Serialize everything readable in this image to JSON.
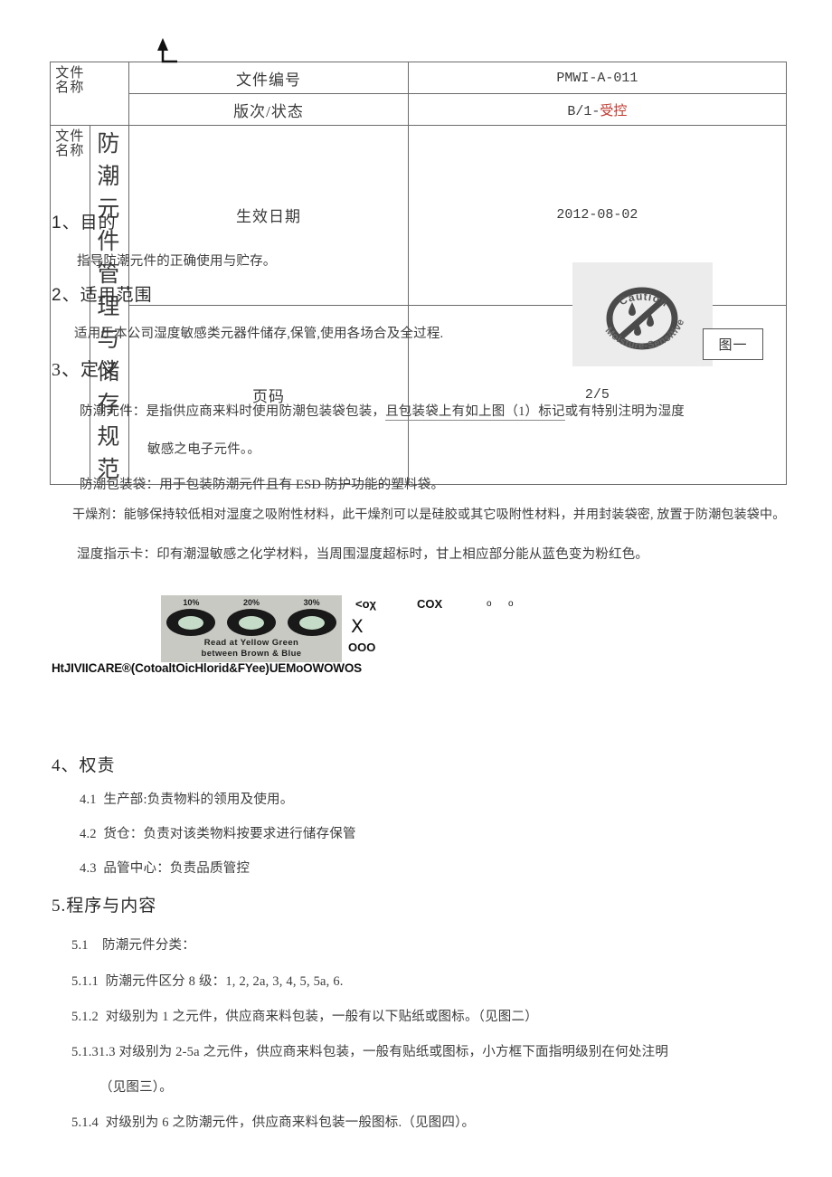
{
  "header_table": {
    "doc_name_label_right": "件称",
    "doc_name_label_left": "文名",
    "title": "防潮元件管理与储存规范",
    "rows": [
      {
        "key": "文件编号",
        "value": "PMWI-A-011",
        "value_red": ""
      },
      {
        "key": "版次/状态",
        "value": "B/1-",
        "value_red": "受控"
      },
      {
        "key": "生效日期",
        "value": "2012-08-02",
        "value_red": ""
      },
      {
        "key": "页码",
        "value": "2/5",
        "value_red": ""
      }
    ]
  },
  "sections": {
    "s1_heading": "1、目的",
    "s1_body": "指导防潮元件的正确使用与贮存。",
    "s2_heading": "2、适用范围",
    "s2_body": "适用于本公司湿度敏感类元器件储存,保管,使用各场合及全过程.",
    "s3_heading": "3、定义",
    "s3_def1_a": "防潮元件：是指供应商来料时使用防潮包装袋包装，",
    "s3_def1_b": "且包装袋上有如上图（1）标记",
    "s3_def1_c": "或有特别注明为湿度",
    "s3_def1_line2": "敏感之电子元件。。",
    "s3_def2": "防潮包装袋：用于包装防潮元件且有 ESD 防护功能的塑料袋。",
    "s3_def3": "干燥剂：能够保持较低相对湿度之吸附性材料，此干燥剂可以是硅胶或其它吸附性材料，并用封装袋密, 放置于防潮包装袋中。",
    "s3_def4": "湿度指示卡：印有潮湿敏感之化学材料，当周围湿度超标时，甘上相应部分能从蓝色变为粉红色。",
    "s4_heading": "4、权责",
    "s4_items": [
      {
        "num": "4.1",
        "text": "生产部:负责物料的领用及使用。"
      },
      {
        "num": "4.2",
        "text": "货仓：负责对该类物料按要求进行储存保管"
      },
      {
        "num": "4.3",
        "text": "品管中心：负责品质管控"
      }
    ],
    "s5_heading": "5.程序与内容",
    "s5_items": [
      {
        "num": "5.1",
        "text": "防潮元件分类："
      },
      {
        "num": "5.1.1",
        "text": "防潮元件区分 8 级：1, 2, 2a, 3, 4, 5, 5a, 6."
      },
      {
        "num": "5.1.2",
        "text": "对级别为 1 之元件，供应商来料包装，一般有以下贴纸或图标。（见图二）"
      },
      {
        "num": "5.1.3",
        "text": "1.3 对级别为 2-5a 之元件，供应商来料包装，一般有贴纸或图标，小方框下面指明级别在何处注明"
      },
      {
        "num": "",
        "text": "（见图三）。"
      },
      {
        "num": "5.1.4",
        "text": "对级别为 6 之防潮元件，供应商来料包装一般图标.（见图四）。"
      }
    ]
  },
  "caution_figure": {
    "top_text": "Caution",
    "bottom_text": "Moisture-Sensitive",
    "figure_label": "图一"
  },
  "hic_figure": {
    "percents": [
      "10%",
      "20%",
      "30%"
    ],
    "line1": "Read at  Yellow Green",
    "line2": "between  Brown & Blue",
    "caption_ocr": "HtJIVIICARE®(CotoaltOicHlorid&FYee)UEMoOWOWOS",
    "stray_glyph_1": "<oχ",
    "stray_glyph_2": "COX",
    "stray_glyph_3": "o",
    "stray_glyph_4": "o",
    "stray_glyph_5": "Ⅹ",
    "stray_glyph_6": "OOO"
  },
  "colors": {
    "red_accent": "#c0372c",
    "text": "#3c3c3c",
    "table_border": "#6b6b6b"
  }
}
